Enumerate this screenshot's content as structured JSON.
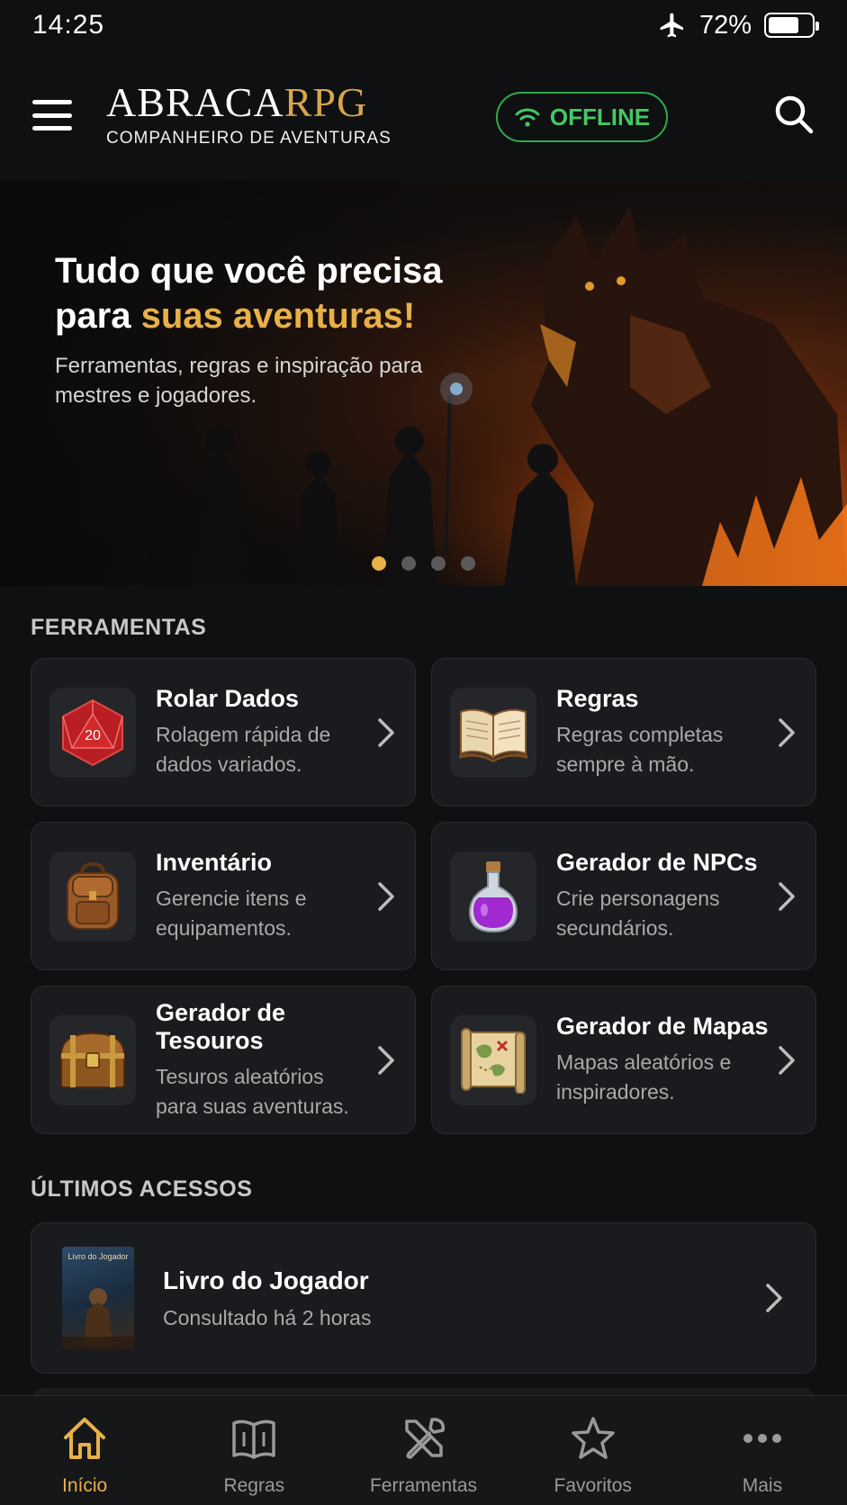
{
  "status_bar": {
    "time": "14:25",
    "battery": "72%",
    "battery_level": 0.72
  },
  "header": {
    "logo_main": "ABRACA",
    "logo_accent": "RPG",
    "tagline": "COMPANHEIRO DE AVENTURAS",
    "offline_label": "OFFLINE"
  },
  "hero": {
    "title_line1": "Tudo que você precisa",
    "title_line2_prefix": "para ",
    "title_line2_accent": "suas aventuras!",
    "subtitle": "Ferramentas, regras e inspiração para mestres e jogadores.",
    "slides": 4,
    "active_slide": 1
  },
  "tools": {
    "section_title": "FERRAMENTAS",
    "items": [
      {
        "title": "Rolar Dados",
        "desc": "Rolagem rápida de dados variados.",
        "icon": "d20-dice-icon",
        "die_number": "20"
      },
      {
        "title": "Regras",
        "desc": "Regras completas sempre à mão.",
        "icon": "open-book-icon"
      },
      {
        "title": "Inventário",
        "desc": "Gerencie itens e equipamentos.",
        "icon": "backpack-icon"
      },
      {
        "title": "Gerador de NPCs",
        "desc": "Crie personagens secundários.",
        "icon": "potion-icon"
      },
      {
        "title": "Gerador de Tesouros",
        "desc": "Tesuros aleatórios para suas aventuras.",
        "icon": "treasure-chest-icon"
      },
      {
        "title": "Gerador de Mapas",
        "desc": "Mapas aleatórios e inspiradores.",
        "icon": "map-scroll-icon"
      }
    ]
  },
  "recent": {
    "section_title": "ÚLTIMOS ACESSOS",
    "items": [
      {
        "title": "Livro do Jogador",
        "subtitle": "Consultado há 2 horas",
        "cover_text": "Livro do Jogador"
      }
    ]
  },
  "bottom_nav": {
    "items": [
      {
        "label": "Início",
        "icon": "home-icon",
        "active": true
      },
      {
        "label": "Regras",
        "icon": "book-icon"
      },
      {
        "label": "Ferramentas",
        "icon": "tools-icon"
      },
      {
        "label": "Favoritos",
        "icon": "star-icon"
      },
      {
        "label": "Mais",
        "icon": "more-icon"
      }
    ]
  },
  "colors": {
    "accent": "#e8b048",
    "online_green": "#45c862",
    "card_bg": "#1a1b1e",
    "background": "#0f1012"
  }
}
